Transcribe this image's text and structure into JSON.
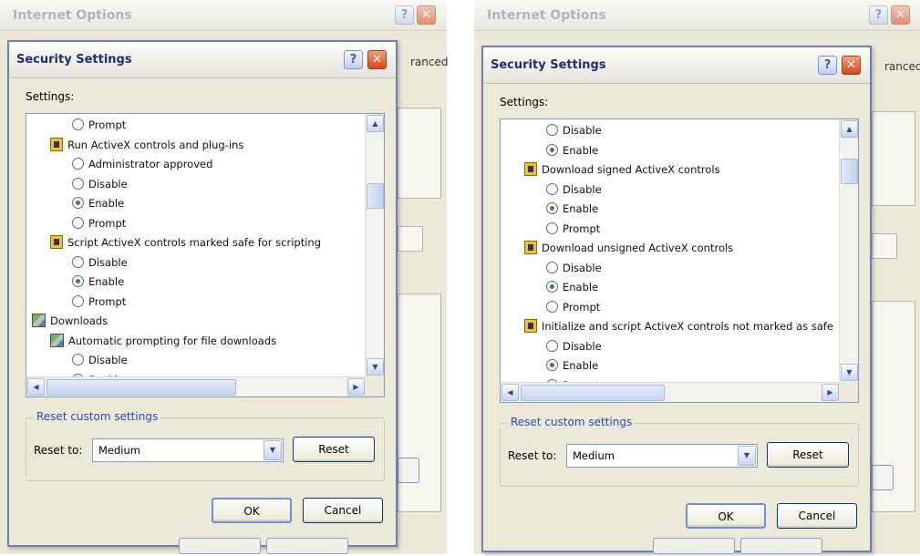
{
  "panels": [
    {
      "window_title": "Internet Options",
      "bg_tab_label": "ranced",
      "dialog_title": "Security Settings",
      "settings_label": "Settings:",
      "rows": [
        {
          "kind": "radio",
          "label": "Prompt",
          "checked": false,
          "indent": 2
        },
        {
          "kind": "category",
          "label": "Run ActiveX controls and plug-ins",
          "indent": 1
        },
        {
          "kind": "radio",
          "label": "Administrator approved",
          "checked": false,
          "indent": 2
        },
        {
          "kind": "radio",
          "label": "Disable",
          "checked": false,
          "indent": 2
        },
        {
          "kind": "radio",
          "label": "Enable",
          "checked": true,
          "indent": 2
        },
        {
          "kind": "radio",
          "label": "Prompt",
          "checked": false,
          "indent": 2
        },
        {
          "kind": "category",
          "label": "Script ActiveX controls marked safe for scripting",
          "indent": 1
        },
        {
          "kind": "radio",
          "label": "Disable",
          "checked": false,
          "indent": 2
        },
        {
          "kind": "radio",
          "label": "Enable",
          "checked": true,
          "indent": 2
        },
        {
          "kind": "radio",
          "label": "Prompt",
          "checked": false,
          "indent": 2
        },
        {
          "kind": "downloads",
          "label": "Downloads",
          "indent": 0
        },
        {
          "kind": "downloads",
          "label": "Automatic prompting for file downloads",
          "indent": 1
        },
        {
          "kind": "radio",
          "label": "Disable",
          "checked": false,
          "indent": 2
        },
        {
          "kind": "radio",
          "label": "Enable",
          "checked": true,
          "indent": 2
        }
      ],
      "reset_group_label": "Reset custom settings",
      "reset_to_label": "Reset to:",
      "reset_to_value": "Medium",
      "reset_button": "Reset",
      "ok_button": "OK",
      "cancel_button": "Cancel"
    },
    {
      "window_title": "Internet Options",
      "bg_tab_label": "ranced",
      "dialog_title": "Security Settings",
      "settings_label": "Settings:",
      "rows": [
        {
          "kind": "radio",
          "label": "Disable",
          "checked": false,
          "indent": 2
        },
        {
          "kind": "radio",
          "label": "Enable",
          "checked": true,
          "indent": 2
        },
        {
          "kind": "category",
          "label": "Download signed ActiveX controls",
          "indent": 1
        },
        {
          "kind": "radio",
          "label": "Disable",
          "checked": false,
          "indent": 2
        },
        {
          "kind": "radio",
          "label": "Enable",
          "checked": true,
          "indent": 2
        },
        {
          "kind": "radio",
          "label": "Prompt",
          "checked": false,
          "indent": 2
        },
        {
          "kind": "category",
          "label": "Download unsigned ActiveX controls",
          "indent": 1
        },
        {
          "kind": "radio",
          "label": "Disable",
          "checked": false,
          "indent": 2
        },
        {
          "kind": "radio",
          "label": "Enable",
          "checked": true,
          "indent": 2
        },
        {
          "kind": "radio",
          "label": "Prompt",
          "checked": false,
          "indent": 2
        },
        {
          "kind": "category",
          "label": "Initialize and script ActiveX controls not marked as safe",
          "indent": 1
        },
        {
          "kind": "radio",
          "label": "Disable",
          "checked": false,
          "indent": 2
        },
        {
          "kind": "radio",
          "label": "Enable",
          "checked": true,
          "indent": 2
        },
        {
          "kind": "radio",
          "label": "Prompt",
          "checked": false,
          "indent": 2
        }
      ],
      "reset_group_label": "Reset custom settings",
      "reset_to_label": "Reset to:",
      "reset_to_value": "Medium",
      "reset_button": "Reset",
      "ok_button": "OK",
      "cancel_button": "Cancel"
    }
  ],
  "scroll": [
    {
      "vertical_fraction": 0.25,
      "horizontal_fraction": 0.0
    },
    {
      "vertical_fraction": 0.1,
      "horizontal_fraction": 0.0
    }
  ],
  "colors": {
    "window_bg": "#ece9d8",
    "link_blue": "#2a49b8",
    "checked_dot": "#3a8a2a",
    "close_red": "#d6451a"
  }
}
